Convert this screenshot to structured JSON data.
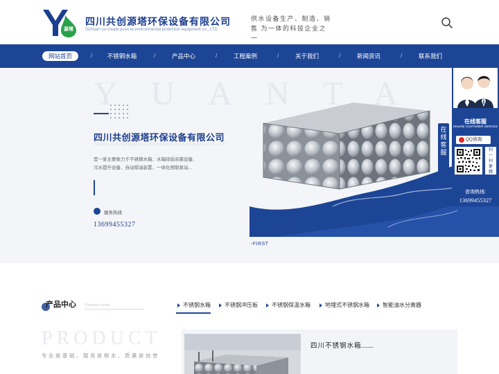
{
  "header": {
    "logo_text": "源塔",
    "company_name_cn": "四川共创源塔环保设备有限公司",
    "company_name_en": "Sichuan co-create yuan ta environmental protection equipment co., LTD",
    "slogan": "供水设备生产、制造、销售 为一体的科技企业之一",
    "search_icon": "search-icon"
  },
  "nav": {
    "items": [
      {
        "label": "网站首页",
        "active": true
      },
      {
        "label": "不锈钢水箱"
      },
      {
        "label": "产品中心"
      },
      {
        "label": "工程案例"
      },
      {
        "label": "关于我们"
      },
      {
        "label": "新闻资讯"
      },
      {
        "label": "联系我们"
      }
    ],
    "separator": "/"
  },
  "hero": {
    "watermark": "YUANTA",
    "title": "四川共创源塔环保设备有限公司",
    "subtitle": "Sichuan co-create yuan ta environmental protection equipment co., LTD",
    "description": "是一家主要致力于不锈钢水箱、水箱除垢杀菌设备、污水提升设备、自动隔油装置、一体化预制泵站...",
    "hotline_label": "服务热线",
    "hotline_number": "13699455327",
    "slide_label": "-FIRST"
  },
  "service": {
    "tab_text": [
      "在",
      "线",
      "客",
      "服"
    ],
    "title": "在线客服",
    "title_en": "ONLINE CUSTOMER SERVICE",
    "qq_label": "QQ咨询",
    "qr_caption": [
      "扫",
      "一",
      "扫",
      "更",
      "精",
      "彩"
    ],
    "consult_label": "咨询热线:",
    "consult_number": "13699455327"
  },
  "products": {
    "title": "产品中心",
    "title_en": "Product center",
    "tabs": [
      {
        "label": "不锈钢水箱",
        "active": true
      },
      {
        "label": "不锈钢冲压板"
      },
      {
        "label": "不锈钢保温水箱"
      },
      {
        "label": "地埋式不锈钢水箱"
      },
      {
        "label": "智能油水分离器"
      }
    ],
    "watermark": "PRODUCT",
    "slogan": "专业是基础、服务是根本、质量是信誉",
    "card_title": "四川不锈钢水箱"
  },
  "colors": {
    "primary": "#1d4596",
    "brand_text": "#1e3f8e",
    "hero_bg": "#f4f5f8",
    "logo_green": "#2aa24a"
  }
}
